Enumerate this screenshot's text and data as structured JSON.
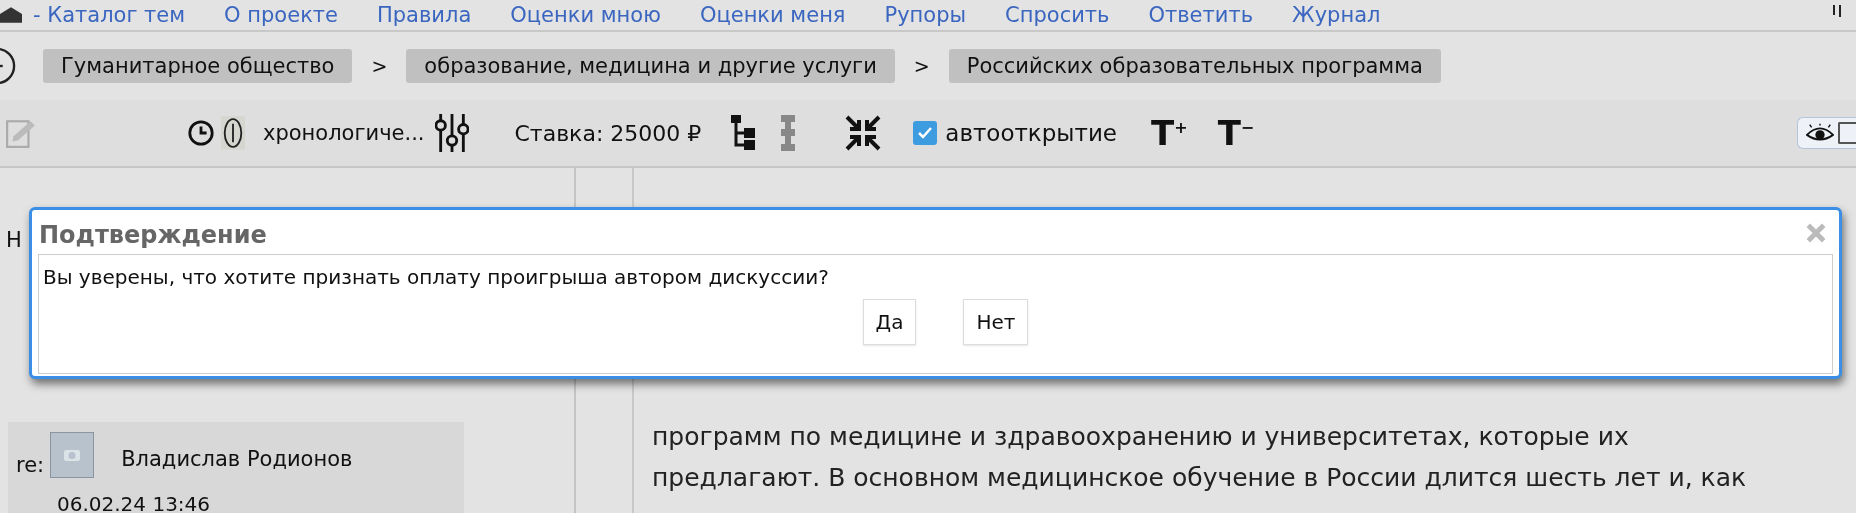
{
  "nav": [
    "- Каталог тем",
    "О проекте",
    "Правила",
    "Оценки мною",
    "Оценки меня",
    "Рупоры",
    "Спросить",
    "Ответить",
    "Журнал"
  ],
  "breadcrumbs": [
    "Гуманитарное общество",
    "образование, медицина и другие услуги",
    "Российских образовательных программа"
  ],
  "breadcrumb_separators": [
    ">",
    ">"
  ],
  "toolbar": {
    "sort_label": "хронологиче...",
    "stake": "Ставка: 25000 ₽",
    "autoopen": {
      "label": "автооткрытие",
      "checked": true
    },
    "font_up": "T$^{+}$",
    "font_down": "T$^{−}$"
  },
  "left_panel": {
    "cut_text": "Н",
    "post": {
      "prefix": "re:",
      "author": "Владислав Родионов",
      "date": "06.02.24 13:46"
    }
  },
  "visibility_toggle": {
    "checked": false
  },
  "article": {
    "lines": [
      "программ по медицине и здравоохранению и университетах, которые их",
      "предлагают. В основном медицинское обучение в России длится шесть лет и, как"
    ]
  },
  "dialog": {
    "title": "Подтверждение",
    "message": "Вы уверены, что хотите признать оплату проигрыша автором дискуссии?",
    "buttons": [
      "Да",
      "Нет"
    ]
  }
}
